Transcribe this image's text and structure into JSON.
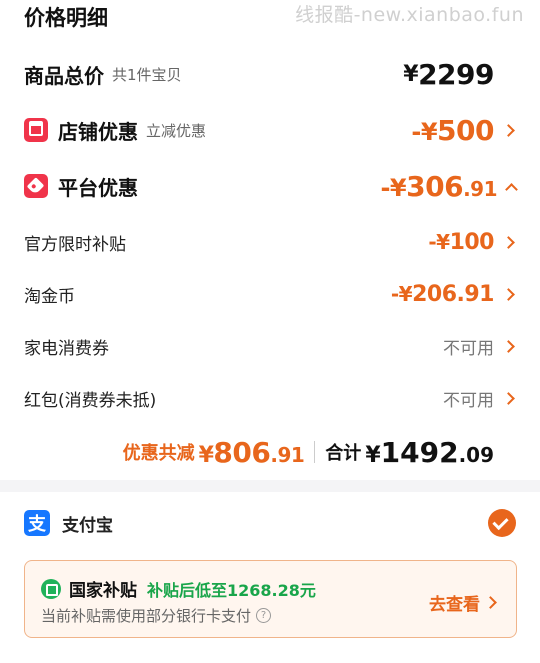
{
  "watermark": "线报酷-new.xianbao.fun",
  "section_title": "价格明细",
  "product_total": {
    "label": "商品总价",
    "sub": "共1件宝贝",
    "currency": "¥",
    "amount": "2299"
  },
  "store_discount": {
    "label": "店铺优惠",
    "sub": "立减优惠",
    "prefix": "-¥",
    "amount": "500",
    "icon": "store-icon"
  },
  "platform_discount": {
    "label": "平台优惠",
    "prefix": "-¥",
    "amount_int": "306",
    "amount_dec": ".91",
    "icon": "tag-icon"
  },
  "items": [
    {
      "label": "官方限时补贴",
      "prefix": "-¥",
      "amount": "100"
    },
    {
      "label": "淘金币",
      "prefix": "-¥",
      "amount": "206.91"
    },
    {
      "label": "家电消费券",
      "status": "不可用"
    },
    {
      "label": "红包(消费券未抵)",
      "status": "不可用"
    }
  ],
  "totals": {
    "discount_label": "优惠共减",
    "discount_currency": "¥",
    "discount_int": "806",
    "discount_dec": ".91",
    "sum_label": "合计",
    "sum_currency": "¥",
    "sum_int": "1492",
    "sum_dec": ".09"
  },
  "payment": {
    "icon_char": "支",
    "label": "支付宝",
    "selected": true
  },
  "subsidy": {
    "title": "国家补贴",
    "highlight": "补贴后低至1268.28元",
    "note": "当前补贴需使用部分银行卡支付",
    "help": "?",
    "action": "去查看"
  },
  "colors": {
    "accent": "#e8661c",
    "badge_red": "#f0344a",
    "alipay_blue": "#1677ff",
    "green": "#19a54a"
  }
}
